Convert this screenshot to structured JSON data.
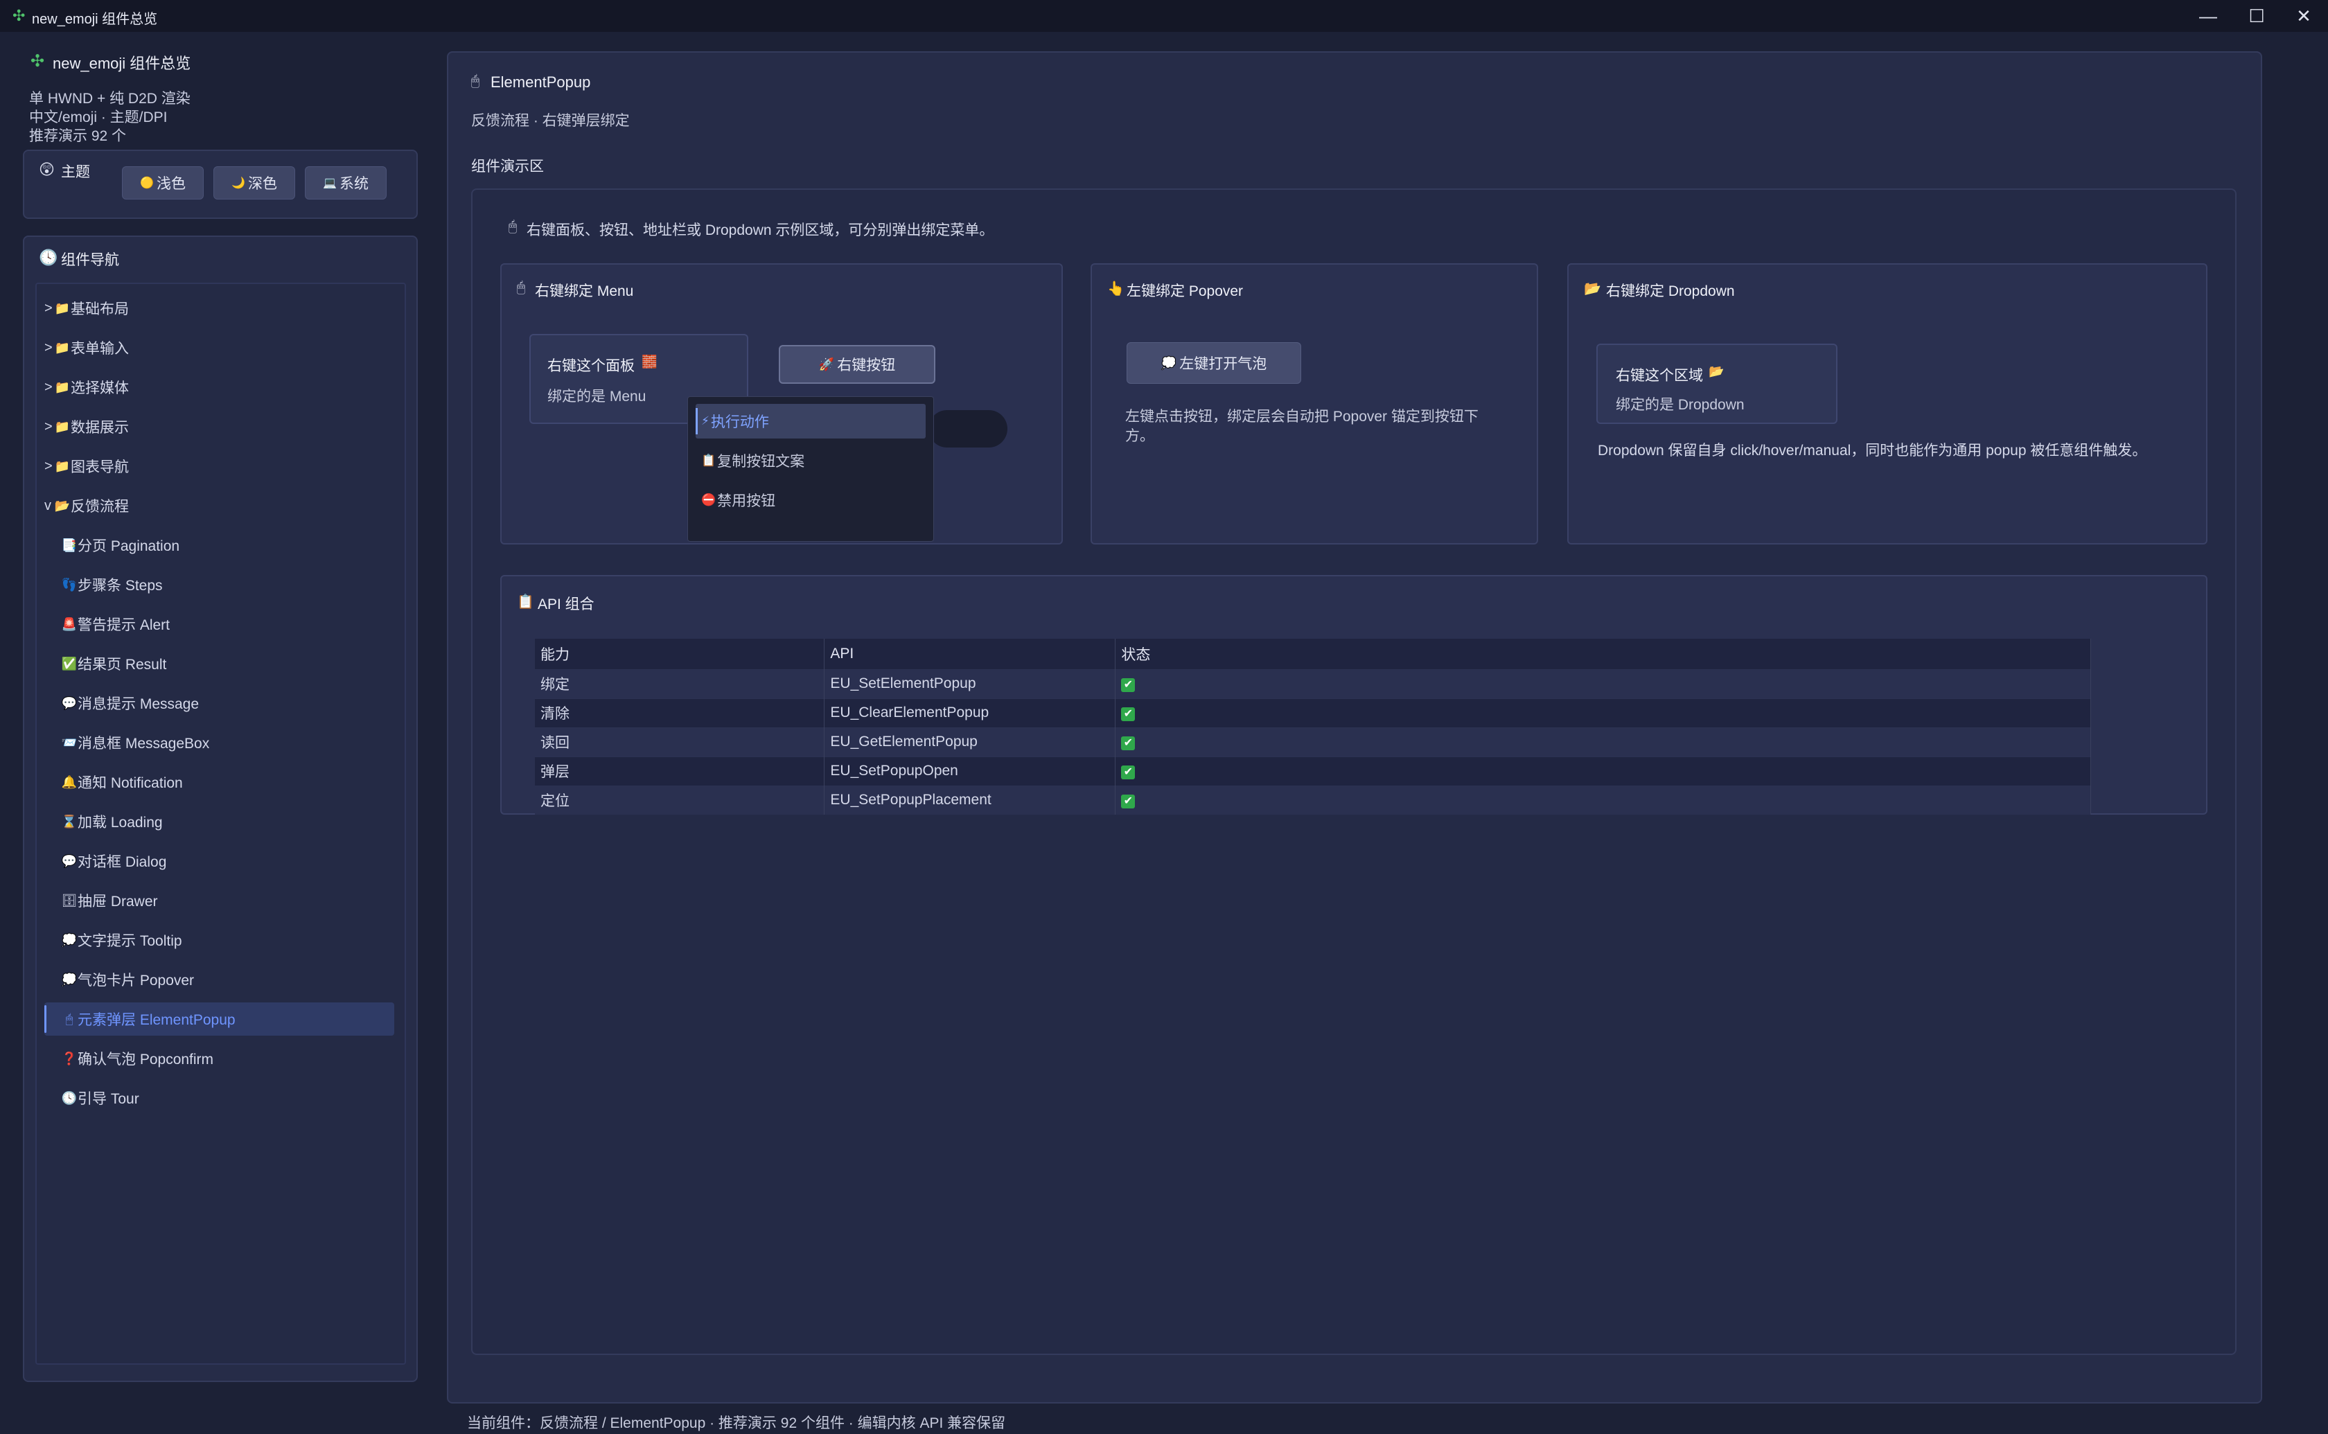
{
  "window": {
    "title_icon": "✣",
    "title": "new_emoji 组件总览",
    "controls": [
      "minimize",
      "maximize",
      "close"
    ]
  },
  "sidebar": {
    "brand_icon": "✣",
    "brand": "new_emoji 组件总览",
    "info": [
      "单 HWND + 纯 D2D 渲染",
      "中文/emoji · 主题/DPI",
      "推荐演示 92 个"
    ],
    "theme": {
      "icon": "😲",
      "label": "主题",
      "buttons": [
        {
          "icon": "🟡",
          "label": "浅色"
        },
        {
          "icon": "🌙",
          "label": "深色"
        },
        {
          "icon": "💻",
          "label": "系统"
        }
      ]
    },
    "nav": {
      "icon": "🕓",
      "title": "组件导航",
      "groups": [
        {
          "caret": ">",
          "icon": "📁",
          "label": "基础布局"
        },
        {
          "caret": ">",
          "icon": "📁",
          "label": "表单输入"
        },
        {
          "caret": ">",
          "icon": "📁",
          "label": "选择媒体"
        },
        {
          "caret": ">",
          "icon": "📁",
          "label": "数据展示"
        },
        {
          "caret": ">",
          "icon": "📁",
          "label": "图表导航"
        },
        {
          "caret": "v",
          "icon": "📂",
          "label": "反馈流程"
        }
      ],
      "children": [
        {
          "icon": "📑",
          "label": "分页 Pagination"
        },
        {
          "icon": "👣",
          "label": "步骤条 Steps"
        },
        {
          "icon": "🚨",
          "label": "警告提示 Alert"
        },
        {
          "icon": "✅",
          "label": "结果页 Result"
        },
        {
          "icon": "💬",
          "label": "消息提示 Message"
        },
        {
          "icon": "📨",
          "label": "消息框 MessageBox"
        },
        {
          "icon": "🔔",
          "label": "通知 Notification"
        },
        {
          "icon": "⌛",
          "label": "加载 Loading"
        },
        {
          "icon": "💬",
          "label": "对话框 Dialog"
        },
        {
          "icon": "🗄",
          "label": "抽屉 Drawer"
        },
        {
          "icon": "💭",
          "label": "文字提示 Tooltip"
        },
        {
          "icon": "💭",
          "label": "气泡卡片 Popover"
        },
        {
          "icon": "🖱",
          "label": "元素弹层 ElementPopup",
          "active": true
        },
        {
          "icon": "❓",
          "label": "确认气泡 Popconfirm"
        },
        {
          "icon": "🕓",
          "label": "引导 Tour"
        }
      ]
    }
  },
  "main": {
    "icon": "🖱",
    "title": "ElementPopup",
    "subtitle": "反馈流程 · 右键弹层绑定",
    "demo_label": "组件演示区",
    "demo_desc_icon": "🖱",
    "demo_desc": "右键面板、按钮、地址栏或 Dropdown 示例区域，可分别弹出绑定菜单。",
    "card_menu": {
      "icon": "🖱",
      "title": "右键绑定 Menu",
      "panel_title": "右键这个面板",
      "panel_icon": "🧱",
      "panel_sub": "绑定的是 Menu",
      "button_icon": "🚀",
      "button": "右键按钮",
      "menu_items": [
        {
          "icon": "⚡",
          "label": "执行动作",
          "active": true
        },
        {
          "icon": "📋",
          "label": "复制按钮文案"
        },
        {
          "icon": "⛔",
          "label": "禁用按钮"
        }
      ]
    },
    "card_popover": {
      "icon": "👆",
      "title": "左键绑定 Popover",
      "button_icon": "💭",
      "button": "左键打开气泡",
      "desc": "左键点击按钮，绑定层会自动把 Popover 锚定到按钮下方。"
    },
    "card_dropdown": {
      "icon": "📂",
      "title": "右键绑定 Dropdown",
      "panel_title": "右键这个区域",
      "panel_icon": "📂",
      "panel_sub": "绑定的是 Dropdown",
      "desc": "Dropdown 保留自身 click/hover/manual，同时也能作为通用 popup 被任意组件触发。"
    },
    "api": {
      "icon": "📋",
      "title": "API 组合",
      "headers": [
        "能力",
        "API",
        "状态"
      ],
      "rows": [
        {
          "cap": "绑定",
          "api": "EU_SetElementPopup",
          "status": "✔"
        },
        {
          "cap": "清除",
          "api": "EU_ClearElementPopup",
          "status": "✔"
        },
        {
          "cap": "读回",
          "api": "EU_GetElementPopup",
          "status": "✔"
        },
        {
          "cap": "弹层",
          "api": "EU_SetPopupOpen",
          "status": "✔"
        },
        {
          "cap": "定位",
          "api": "EU_SetPopupPlacement",
          "status": "✔"
        }
      ]
    }
  },
  "statusbar": "当前组件：反馈流程 / ElementPopup · 推荐演示 92 个组件 · 编辑内核 API 兼容保留"
}
